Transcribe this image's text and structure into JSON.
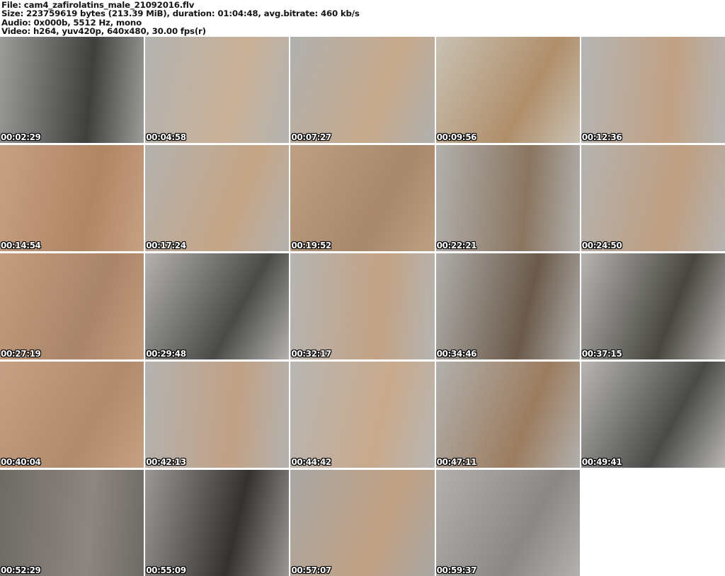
{
  "header": {
    "file_line": "File: cam4_zafirolatins_male_21092016.flv",
    "size_line": "Size: 223759619 bytes (213.39 MiB), duration: 01:04:48, avg.bitrate: 460 kb/s",
    "audio_line": "Audio: 0x000b, 5512 Hz, mono",
    "video_line": "Video: h264, yuv420p, 640x480, 30.00 fps(r)"
  },
  "grid": {
    "columns": 5,
    "rows": 5,
    "gap_color": "#ffffff"
  },
  "colors": {
    "page_background": "#ffffff",
    "header_text": "#141414",
    "timestamp_text": "#ffffff",
    "timestamp_outline": "#000000"
  },
  "thumbnails": [
    {
      "time": "00:02:29",
      "tones": [
        "#9c9c9a",
        "#3f3f3d"
      ]
    },
    {
      "time": "00:04:58",
      "tones": [
        "#b3b3b1",
        "#c9b096"
      ]
    },
    {
      "time": "00:07:27",
      "tones": [
        "#b0b0ae",
        "#c7a98b"
      ]
    },
    {
      "time": "00:09:56",
      "tones": [
        "#c9c2b4",
        "#b08e6a"
      ]
    },
    {
      "time": "00:12:36",
      "tones": [
        "#b5b5b3",
        "#c2a184"
      ]
    },
    {
      "time": "00:14:54",
      "tones": [
        "#c7a083",
        "#b08664"
      ]
    },
    {
      "time": "00:17:24",
      "tones": [
        "#b3b1ae",
        "#c6a585"
      ]
    },
    {
      "time": "00:19:52",
      "tones": [
        "#bda083",
        "#a8876a"
      ]
    },
    {
      "time": "00:22:21",
      "tones": [
        "#b2b0ad",
        "#8a7560"
      ]
    },
    {
      "time": "00:24:50",
      "tones": [
        "#b5b3b0",
        "#bf9e80"
      ]
    },
    {
      "time": "00:27:19",
      "tones": [
        "#c49d7e",
        "#a98468"
      ]
    },
    {
      "time": "00:29:48",
      "tones": [
        "#b4b2af",
        "#4a4a48"
      ]
    },
    {
      "time": "00:32:17",
      "tones": [
        "#b6b4b1",
        "#c3a284"
      ]
    },
    {
      "time": "00:34:46",
      "tones": [
        "#b0aeab",
        "#6b5a4a"
      ]
    },
    {
      "time": "00:37:15",
      "tones": [
        "#b7b5b2",
        "#47463f"
      ]
    },
    {
      "time": "00:40:04",
      "tones": [
        "#c6a083",
        "#b08a6b"
      ]
    },
    {
      "time": "00:42:13",
      "tones": [
        "#b4b2af",
        "#c2a185"
      ]
    },
    {
      "time": "00:44:42",
      "tones": [
        "#b8b6b3",
        "#c9a98b"
      ]
    },
    {
      "time": "00:47:11",
      "tones": [
        "#b2b0ad",
        "#9c7c5f"
      ]
    },
    {
      "time": "00:49:41",
      "tones": [
        "#b9b7b4",
        "#4a4a48"
      ]
    },
    {
      "time": "00:52:29",
      "tones": [
        "#6e6a66",
        "#8d8680"
      ]
    },
    {
      "time": "00:55:09",
      "tones": [
        "#9b9794",
        "#34322f"
      ]
    },
    {
      "time": "00:57:07",
      "tones": [
        "#a9a7a4",
        "#c2a183"
      ]
    },
    {
      "time": "00:59:37",
      "tones": [
        "#b3b1ae",
        "#8a8885"
      ]
    },
    {
      "empty": true
    }
  ]
}
